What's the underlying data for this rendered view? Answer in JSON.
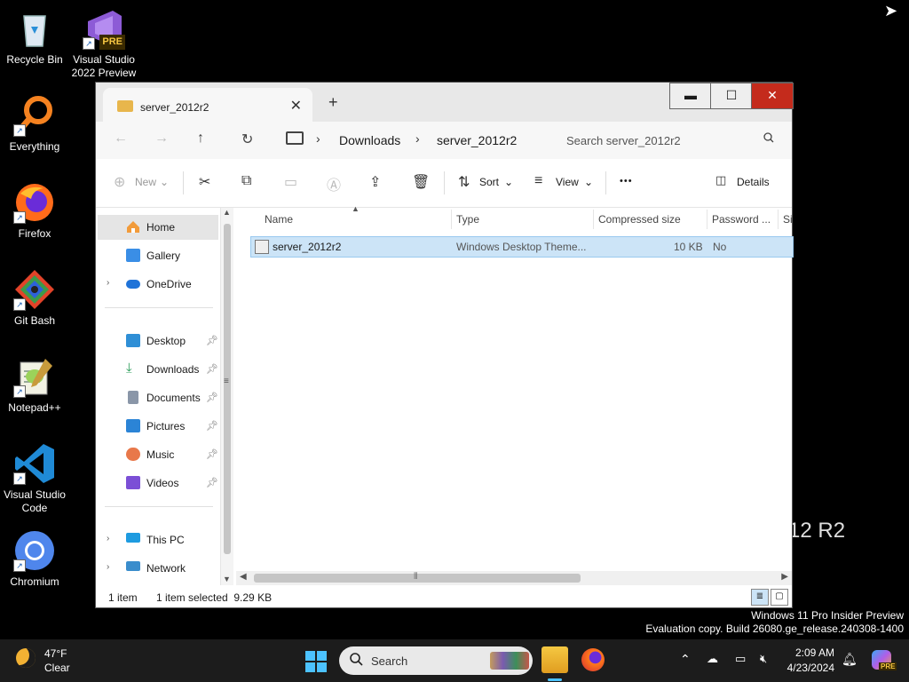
{
  "desktop": {
    "icons": [
      {
        "label": "Recycle Bin"
      },
      {
        "label": "Visual Studio 2022 Preview",
        "badge": "PRE"
      },
      {
        "label": "Everything"
      },
      {
        "label": "Firefox"
      },
      {
        "label": "Git Bash"
      },
      {
        "label": "Notepad++"
      },
      {
        "label": "Visual Studio Code"
      },
      {
        "label": "Chromium"
      }
    ],
    "watermark_line1": "Windows 11 Pro Insider Preview",
    "watermark_line2": "Evaluation copy. Build 26080.ge_release.240308-1400",
    "background_text": "12 R2"
  },
  "window": {
    "tab_title": "server_2012r2",
    "tab_close": "✕",
    "new_tab": "+",
    "controls": {
      "minimize": "▬",
      "maximize": "☐",
      "close": "✕"
    },
    "nav": {
      "back": "←",
      "forward": "→",
      "up": "↑",
      "refresh": "↻",
      "breadcrumb": [
        "Downloads",
        "server_2012r2"
      ],
      "search_placeholder": "Search server_2012r2"
    },
    "toolbar": {
      "new_label": "New",
      "sort_label": "Sort",
      "view_label": "View",
      "more": "•••",
      "details_label": "Details"
    },
    "sidebar": {
      "home": "Home",
      "gallery": "Gallery",
      "onedrive": "OneDrive",
      "desktop": "Desktop",
      "downloads": "Downloads",
      "documents": "Documents",
      "pictures": "Pictures",
      "music": "Music",
      "videos": "Videos",
      "thispc": "This PC",
      "network": "Network"
    },
    "columns": [
      "Name",
      "Type",
      "Compressed size",
      "Password ...",
      "Si"
    ],
    "rows": [
      {
        "name": "server_2012r2",
        "type": "Windows Desktop Theme...",
        "size": "10 KB",
        "password": "No"
      }
    ],
    "status": {
      "count": "1 item",
      "selected": "1 item selected  9.29 KB"
    }
  },
  "taskbar": {
    "weather_temp": "47°F",
    "weather_desc": "Clear",
    "search_placeholder": "Search",
    "time": "2:09 AM",
    "date": "4/23/2024"
  }
}
